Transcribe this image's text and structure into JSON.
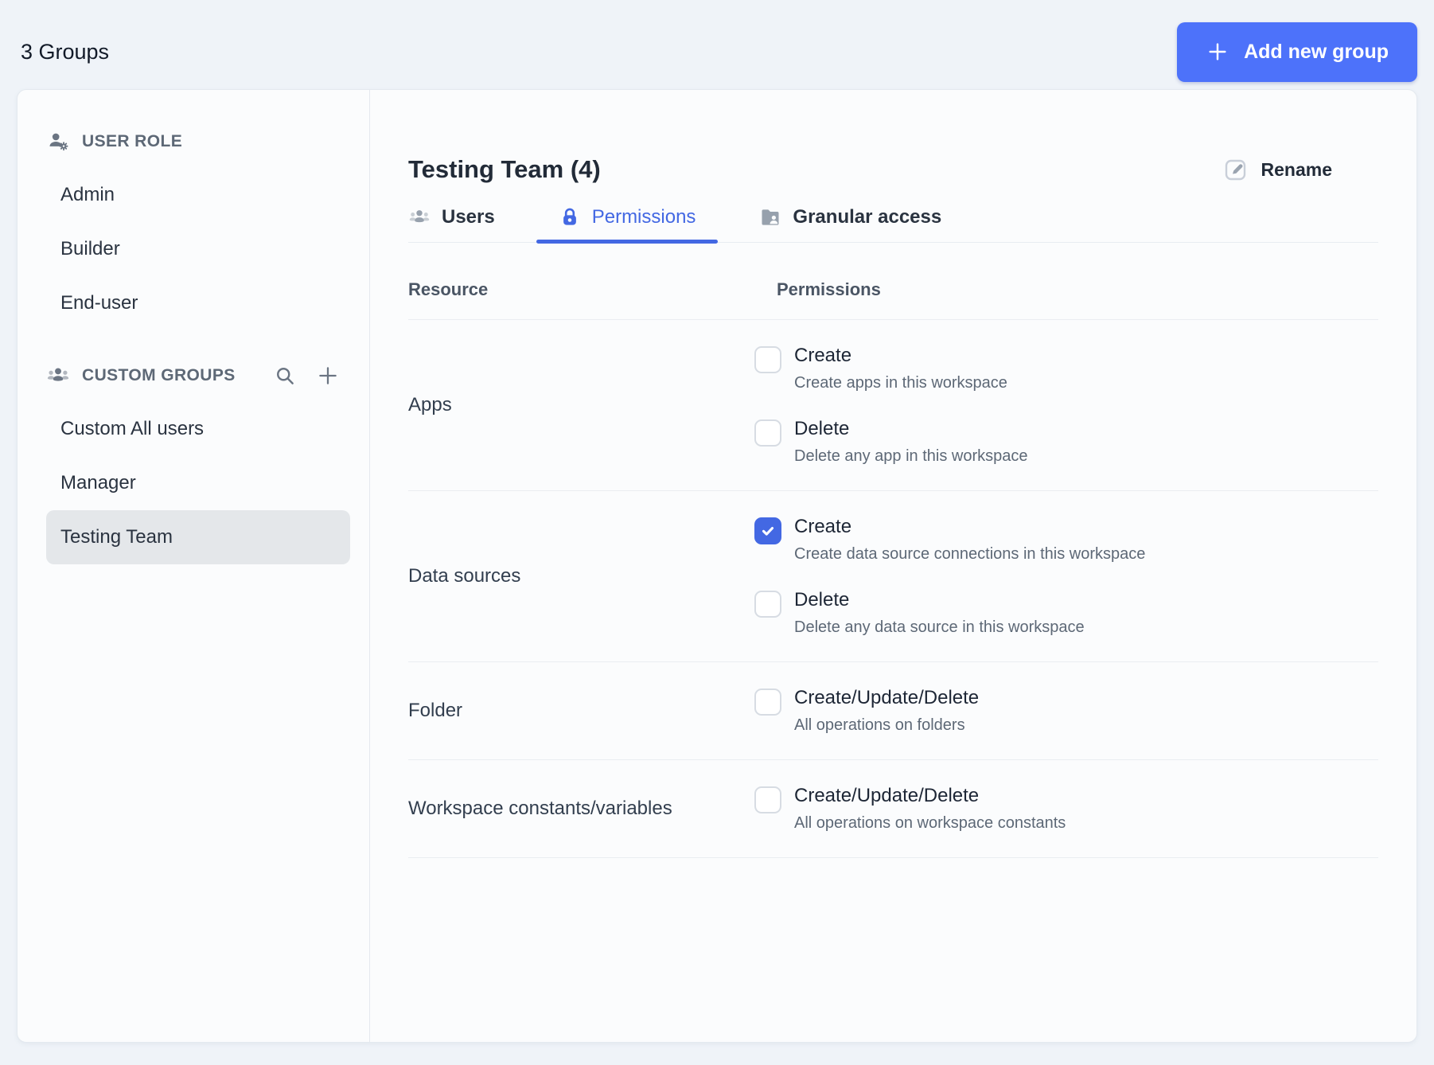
{
  "colors": {
    "accent": "#4d72fa",
    "accent_dark": "#4368e3",
    "page_bg": "#eff3f8",
    "card_bg": "#fbfcfd",
    "selected_item_bg": "#e4e7ea"
  },
  "header": {
    "title": "3 Groups",
    "add_button_label": "Add new group",
    "add_button_icon": "plus-icon"
  },
  "sidebar": {
    "sections": [
      {
        "label": "USER ROLE",
        "icon": "user-gear-icon",
        "items": [
          {
            "label": "Admin",
            "selected": false
          },
          {
            "label": "Builder",
            "selected": false
          },
          {
            "label": "End-user",
            "selected": false
          }
        ]
      },
      {
        "label": "CUSTOM GROUPS",
        "icon": "people-icon",
        "has_search": true,
        "has_add": true,
        "items": [
          {
            "label": "Custom All users",
            "selected": false
          },
          {
            "label": "Manager",
            "selected": false
          },
          {
            "label": "Testing Team",
            "selected": true
          }
        ]
      }
    ]
  },
  "main": {
    "title": "Testing Team (4)",
    "rename_label": "Rename",
    "rename_icon": "edit-icon",
    "tabs": [
      {
        "label": "Users",
        "icon": "people-icon",
        "active": false
      },
      {
        "label": "Permissions",
        "icon": "lock-icon",
        "active": true
      },
      {
        "label": "Granular access",
        "icon": "folder-user-icon",
        "active": false
      }
    ],
    "table": {
      "columns": [
        "Resource",
        "Permissions"
      ],
      "rows": [
        {
          "resource": "Apps",
          "permissions": [
            {
              "label": "Create",
              "description": "Create apps in this workspace",
              "checked": false
            },
            {
              "label": "Delete",
              "description": "Delete any app in this workspace",
              "checked": false
            }
          ]
        },
        {
          "resource": "Data sources",
          "permissions": [
            {
              "label": "Create",
              "description": "Create data source connections in this workspace",
              "checked": true
            },
            {
              "label": "Delete",
              "description": "Delete any data source in this workspace",
              "checked": false
            }
          ]
        },
        {
          "resource": "Folder",
          "permissions": [
            {
              "label": "Create/Update/Delete",
              "description": "All operations on folders",
              "checked": false
            }
          ]
        },
        {
          "resource": "Workspace constants/variables",
          "permissions": [
            {
              "label": "Create/Update/Delete",
              "description": "All operations on workspace constants",
              "checked": false
            }
          ]
        }
      ]
    }
  }
}
